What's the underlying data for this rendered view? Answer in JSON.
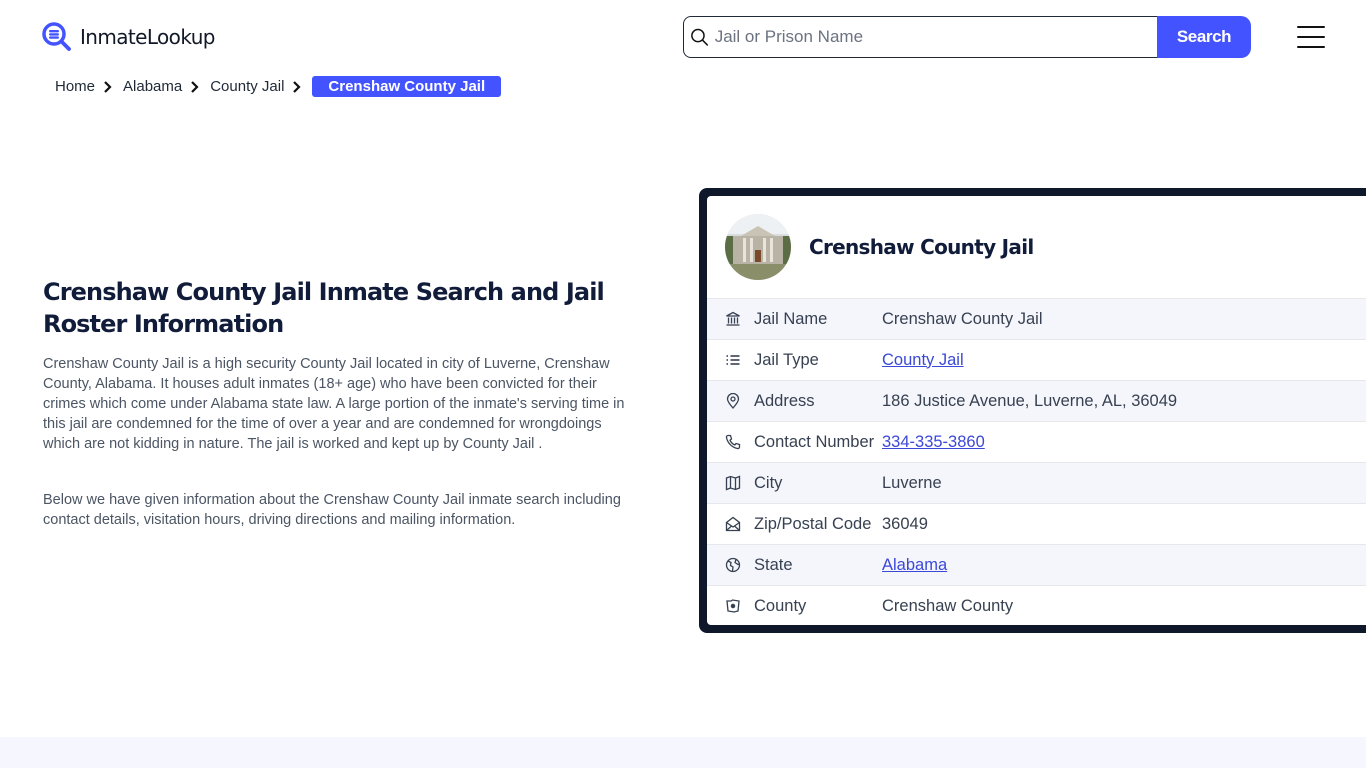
{
  "header": {
    "logo_text": "InmateLookup",
    "search_placeholder": "Jail or Prison Name",
    "search_value": "",
    "search_button": "Search",
    "menu_icon": "hamburger-menu-icon"
  },
  "breadcrumb": {
    "items": [
      "Home",
      "Alabama",
      "County Jail"
    ],
    "active": "Crenshaw County Jail"
  },
  "main": {
    "title": "Crenshaw County Jail Inmate Search and Jail Roster Information",
    "paragraphs": [
      "Crenshaw County Jail is a high security County Jail located in city of Luverne, Crenshaw County, Alabama. It houses adult inmates (18+ age) who have been convicted for their crimes which come under Alabama state law. A large portion of the inmate's serving time in this jail are condemned for the time of over a year and are condemned for wrongdoings which are not kidding in nature. The jail is worked and kept up by County Jail .",
      "Below we have given information about the Crenshaw County Jail inmate search including contact details, visitation hours, driving directions and mailing information."
    ]
  },
  "card": {
    "title": "Crenshaw County Jail",
    "rows": [
      {
        "icon": "building-columns-icon",
        "label": "Jail Name",
        "value": "Crenshaw County Jail",
        "link": false
      },
      {
        "icon": "list-icon",
        "label": "Jail Type",
        "value": "County Jail",
        "link": true
      },
      {
        "icon": "map-pin-icon",
        "label": "Address",
        "value": "186 Justice Avenue, Luverne, AL, 36049",
        "link": false
      },
      {
        "icon": "phone-icon",
        "label": "Contact Number",
        "value": "334-335-3860",
        "link": true
      },
      {
        "icon": "map-icon",
        "label": "City",
        "value": "Luverne",
        "link": false
      },
      {
        "icon": "mail-open-icon",
        "label": "Zip/Postal Code",
        "value": "36049",
        "link": false
      },
      {
        "icon": "globe-icon",
        "label": "State",
        "value": "Alabama",
        "link": true
      },
      {
        "icon": "county-map-icon",
        "label": "County",
        "value": "Crenshaw County",
        "link": false
      }
    ]
  },
  "colors": {
    "accent": "#4353ff",
    "heading": "#111c3a",
    "card_border": "#0f172a",
    "link": "#3b48d8",
    "row_alt": "#f5f6fc"
  }
}
